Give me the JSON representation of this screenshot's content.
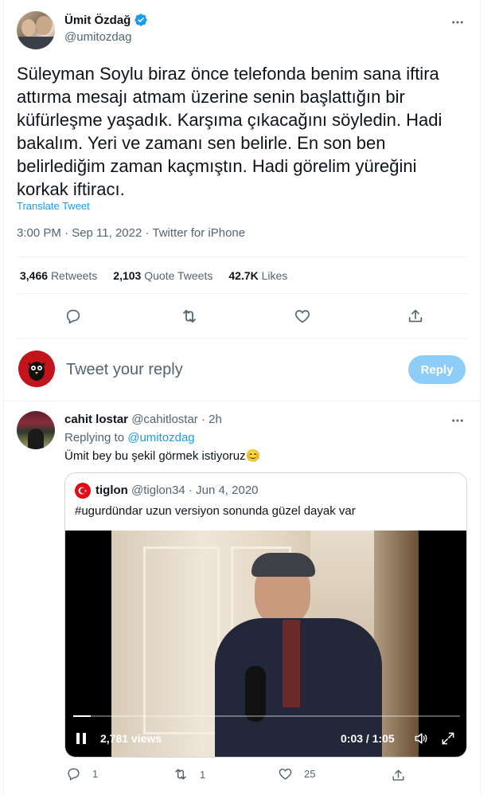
{
  "tweet": {
    "author_name": "Ümit Özdağ",
    "author_handle": "@umitozdag",
    "text": "Süleyman Soylu biraz önce telefonda benim sana iftira attırma mesajı atmam üzerine senin başlattığın bir küfürleşme yaşadık. Karşıma çıkacağını söyledin. Hadi bakalım. Yeri ve zamanı sen belirle. En son ben belirlediğim zaman kaçmıştın. Hadi görelim yüreğini korkak iftiracı.",
    "translate_label": "Translate Tweet",
    "timestamp": "3:00 PM · Sep 11, 2022 · Twitter for iPhone",
    "stats": {
      "retweets_count": "3,466",
      "retweets_label": "Retweets",
      "quotes_count": "2,103",
      "quotes_label": "Quote Tweets",
      "likes_count": "42.7K",
      "likes_label": "Likes"
    },
    "actions": [
      "reply-icon",
      "retweet-icon",
      "like-icon",
      "share-icon"
    ]
  },
  "composer": {
    "placeholder": "Tweet your reply",
    "reply_button": "Reply"
  },
  "reply": {
    "author_name": "cahit lostar",
    "author_handle": "@cahitlostar",
    "time": "· 2h",
    "replying_prefix": "Replying to",
    "replying_handle": "@umitozdag",
    "text": "Ümit bey bu şekil görmek istiyoruz😊",
    "quoted": {
      "author_name": "tiglon",
      "author_handle": "@tiglon34",
      "date": "· Jun 4, 2020",
      "text": "#ugurdündar uzun versiyon sonunda güzel dayak var",
      "video": {
        "views": "2,781 views",
        "time": "0:03 / 1:05",
        "progress": 0.046
      }
    },
    "actions": {
      "reply_count": "1",
      "retweet_count": "1",
      "like_count": "25"
    }
  },
  "colors": {
    "accent": "#1d9bf0",
    "muted": "#536471",
    "border": "#eff3f4"
  }
}
